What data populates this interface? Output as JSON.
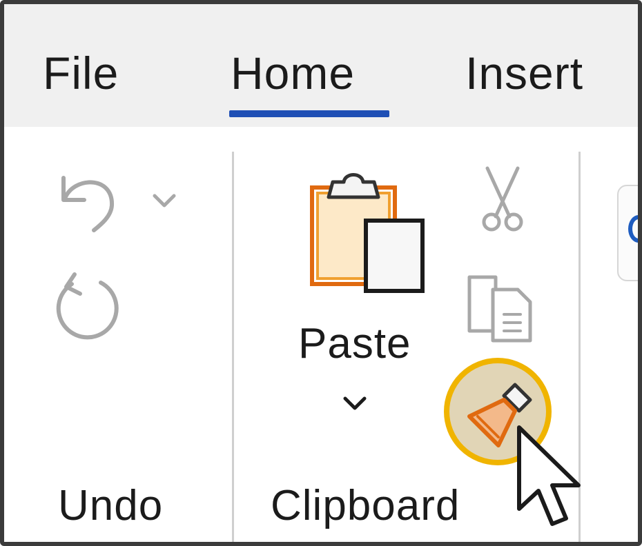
{
  "tabs": {
    "file": "File",
    "home": "Home",
    "insert": "Insert",
    "active": "Home"
  },
  "groups": {
    "undo": {
      "label": "Undo",
      "icons": [
        "undo-icon",
        "undo-dropdown-chevron-icon",
        "redo-icon"
      ]
    },
    "clipboard": {
      "label": "Clipboard",
      "paste_label": "Paste",
      "icons": [
        "paste-icon",
        "paste-dropdown-chevron-icon",
        "cut-icon",
        "copy-icon",
        "format-painter-icon"
      ]
    }
  },
  "highlight": {
    "target": "format-painter-icon",
    "ring_color": "#f0b400"
  },
  "colors": {
    "tab_underline": "#1f4fb5",
    "accent_orange": "#e06a10",
    "clipboard_orange": "#f0a030",
    "disabled_gray": "#a8a8a8"
  }
}
